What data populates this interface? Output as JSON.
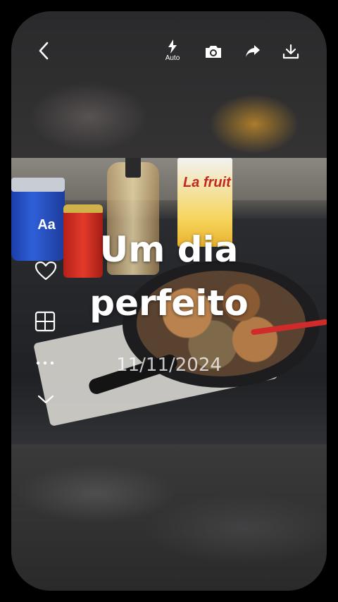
{
  "topbar": {
    "back_icon": "chevron-left-icon",
    "flash_icon": "flash-auto-icon",
    "flash_label": "Auto",
    "camera_icon": "camera-icon",
    "share_icon": "share-icon",
    "download_icon": "download-icon"
  },
  "photo": {
    "carton_text": "La fruit"
  },
  "overlay": {
    "title_line1": "Um dia",
    "title_line2": "perfeito",
    "date": "11/11/2024"
  },
  "toolbar": {
    "text_tool_label": "Aa",
    "heart_icon": "heart-icon",
    "layout_icon": "layout-grid-icon",
    "more_icon": "more-dots-icon",
    "collapse_icon": "chevron-down-icon"
  },
  "colors": {
    "background": "#000000",
    "icon": "#ffffff"
  }
}
